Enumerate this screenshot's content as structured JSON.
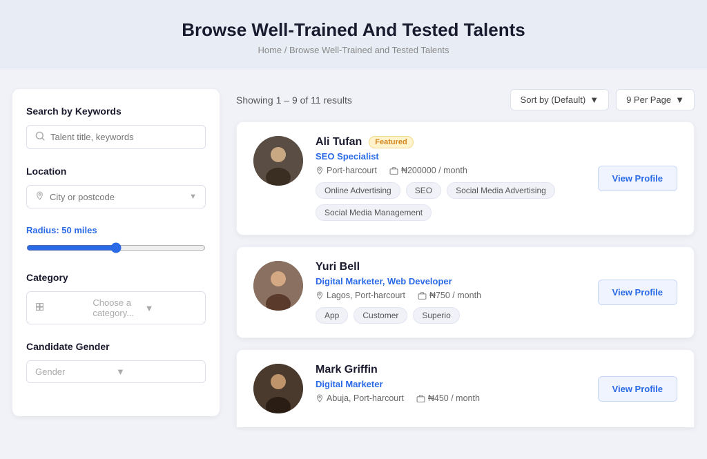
{
  "hero": {
    "title": "Browse Well-Trained And Tested Talents",
    "breadcrumb_home": "Home",
    "breadcrumb_sep": "/",
    "breadcrumb_current": "Browse Well-Trained and Tested Talents"
  },
  "sidebar": {
    "keywords_label": "Search by Keywords",
    "keywords_placeholder": "Talent title, keywords",
    "location_label": "Location",
    "location_placeholder": "City or postcode",
    "radius_label": "Radius: 50 miles",
    "radius_value": "50",
    "category_label": "Category",
    "category_placeholder": "Choose a category...",
    "gender_label": "Candidate Gender",
    "gender_placeholder": "Gender"
  },
  "results": {
    "summary": "Showing 1 – 9 of 11 results",
    "sort_label": "Sort by (Default)",
    "per_page_label": "9 Per Page"
  },
  "talents": [
    {
      "name": "Ali Tufan",
      "featured": true,
      "featured_label": "Featured",
      "title": "SEO Specialist",
      "location": "Port-harcourt",
      "salary": "₦200000 / month",
      "tags": [
        "Online Advertising",
        "SEO",
        "Social Media Advertising",
        "Social Media Management"
      ],
      "profile_btn": "View Profile",
      "avatar_color": "#5a4e44"
    },
    {
      "name": "Yuri Bell",
      "featured": false,
      "featured_label": "",
      "title": "Digital Marketer, Web Developer",
      "location": "Lagos, Port-harcourt",
      "salary": "₦750 / month",
      "tags": [
        "App",
        "Customer",
        "Superio"
      ],
      "profile_btn": "View Profile",
      "avatar_color": "#7a6a5a"
    },
    {
      "name": "Mark Griffin",
      "featured": false,
      "featured_label": "",
      "title": "Digital Marketer",
      "location": "Abuja, Port-harcourt",
      "salary": "₦450 / month",
      "tags": [],
      "profile_btn": "View Profile",
      "avatar_color": "#4a3a2e"
    }
  ]
}
